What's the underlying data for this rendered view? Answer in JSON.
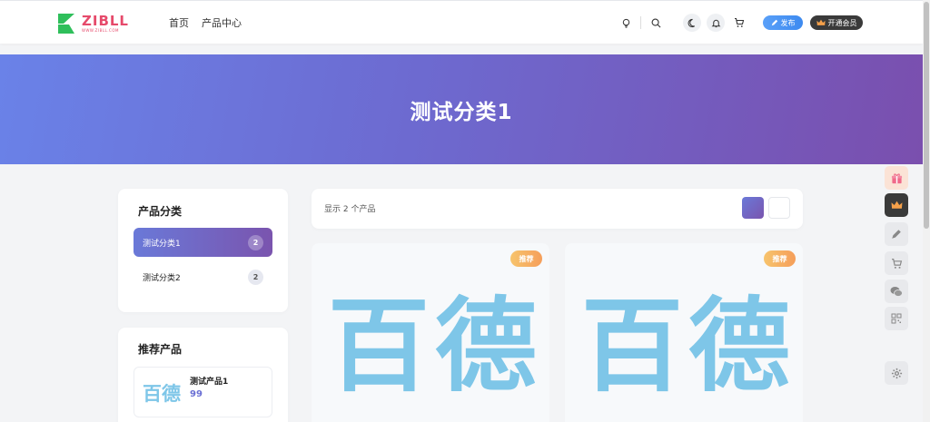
{
  "header": {
    "logo_word": "ZIBLL",
    "logo_sub": "WWW.ZIBLL.COM",
    "nav": [
      {
        "label": "首页"
      },
      {
        "label": "产品中心"
      }
    ],
    "publish_label": "发布",
    "vip_label": "开通会员"
  },
  "banner": {
    "title": "测试分类1"
  },
  "categories": {
    "title": "产品分类",
    "items": [
      {
        "label": "测试分类1",
        "count": "2",
        "active": true
      },
      {
        "label": "测试分类2",
        "count": "2",
        "active": false
      }
    ]
  },
  "recommend": {
    "title": "推荐产品",
    "items": [
      {
        "thumb_text": "百德",
        "name": "测试产品1",
        "price": "99"
      }
    ]
  },
  "toolbar": {
    "result_text": "显示 2 个产品"
  },
  "products": [
    {
      "badge": "推荐",
      "image_text": "百德"
    },
    {
      "badge": "推荐",
      "image_text": "百德"
    }
  ],
  "colors": {
    "accent_start": "#6a79d8",
    "accent_end": "#7a54ae",
    "publish_blue": "#3d8af0",
    "badge_orange": "#f59e5a",
    "logo_green": "#2fbf5b",
    "logo_pink": "#e64a6b"
  },
  "icons": {
    "header": [
      "lightbulb-icon",
      "search-icon",
      "moon-icon",
      "bell-icon",
      "cart-icon"
    ],
    "float": [
      "gift-icon",
      "crown-icon",
      "pencil-icon",
      "cart-icon",
      "wechat-icon",
      "qrcode-icon",
      "gear-icon"
    ]
  }
}
